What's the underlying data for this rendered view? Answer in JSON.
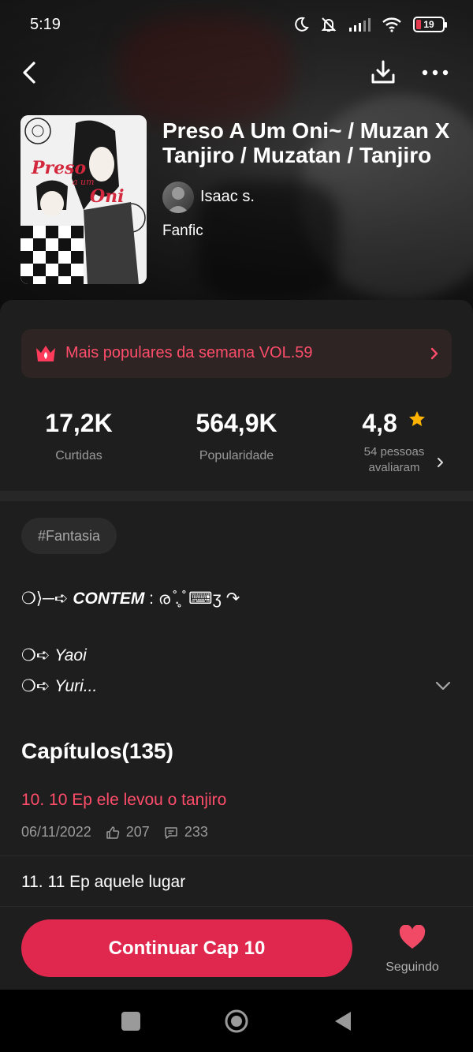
{
  "status_bar": {
    "time": "5:19",
    "battery": "19"
  },
  "book": {
    "title": "Preso A Um Oni~ / Muzan X Tanjiro / Muzatan / Tanjiro",
    "author": "Isaac s.",
    "category": "Fanfic",
    "cover_title": "Preso",
    "cover_subtitle": "a um",
    "cover_title_2": "Oni"
  },
  "ranking": {
    "label": "Mais populares da semana VOL.59"
  },
  "stats": {
    "likes_value": "17,2K",
    "likes_label": "Curtidas",
    "popularity_value": "564,9K",
    "popularity_label": "Popularidade",
    "rating_value": "4,8",
    "rating_label_1": "54 pessoas",
    "rating_label_2": "avaliaram"
  },
  "tag": "#Fantasia",
  "description": {
    "line1_prefix": "❍⟩─➪ ",
    "line1_strong": "CONTEM",
    "line1_suffix": " : ര ̊.̥ ̊ ⌨ʒ ↷",
    "line2_prefix": "❍➪ ",
    "line2_text": "Yaoi",
    "line3_prefix": "❍➪ ",
    "line3_text": "Yuri..."
  },
  "chapters": {
    "heading": "Capítulos(135)",
    "items": [
      {
        "title": "10. 10 Ep ele levou o tanjiro",
        "date": "06/11/2022",
        "likes": "207",
        "comments": "233"
      },
      {
        "title": "11. 11 Ep aquele lugar"
      }
    ]
  },
  "actions": {
    "continue_label": "Continuar Cap 10",
    "follow_label": "Seguindo"
  },
  "colors": {
    "accent": "#e0284f",
    "accent_text": "#ff4d6a",
    "star": "#ffb300"
  }
}
